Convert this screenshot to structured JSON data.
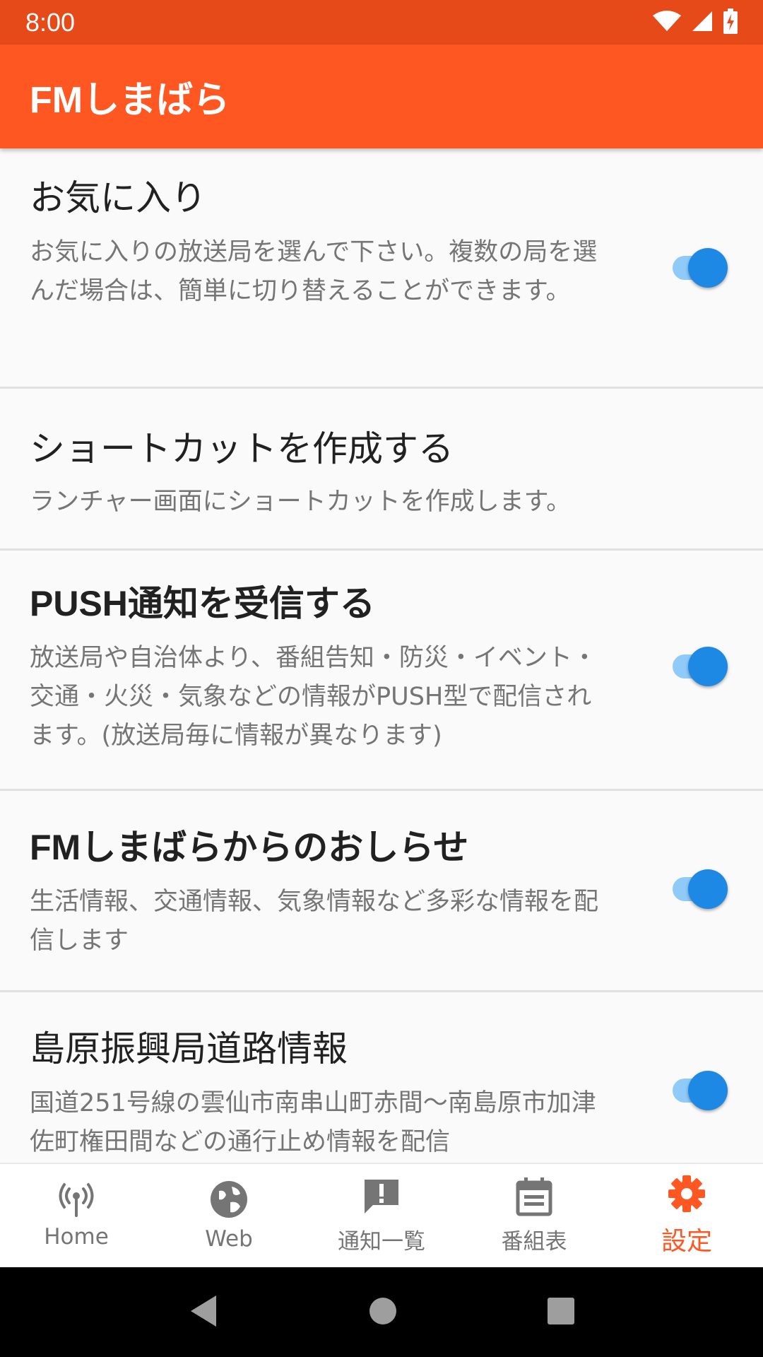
{
  "status_bar": {
    "time": "8:00",
    "icons": [
      "wifi-icon",
      "cell-signal-icon",
      "battery-charging-icon"
    ]
  },
  "app_bar": {
    "title": "FMしまばら"
  },
  "preferences": [
    {
      "title": "お気に入り",
      "summary": "お気に入りの放送局を選んで下さい。複数の局を選んだ場合は、簡単に切り替えることができます。",
      "switch_on": true
    },
    {
      "title": "ショートカットを作成する",
      "summary": "ランチャー画面にショートカットを作成します。"
    },
    {
      "title": "PUSH通知を受信する",
      "summary": "放送局や自治体より、番組告知・防災・イベント・交通・火災・気象などの情報がPUSH型で配信されます。(放送局毎に情報が異なります)",
      "switch_on": true
    },
    {
      "title": "FMしまばらからのおしらせ",
      "summary": "生活情報、交通情報、気象情報など多彩な情報を配信します",
      "switch_on": true
    },
    {
      "title": "島原振興局道路情報",
      "summary": "国道251号線の雲仙市南串山町赤間〜南島原市加津佐町権田間などの通行止め情報を配信",
      "switch_on": true
    }
  ],
  "bottom_nav": [
    {
      "label": "Home",
      "icon": "radio-tower-icon"
    },
    {
      "label": "Web",
      "icon": "globe-icon"
    },
    {
      "label": "通知一覧",
      "icon": "notification-alert-icon"
    },
    {
      "label": "番組表",
      "icon": "calendar-icon"
    },
    {
      "label": "設定",
      "icon": "gear-icon",
      "active": true
    }
  ],
  "colors": {
    "status_bar": "#e64a19",
    "app_bar": "#ff5722",
    "switch_thumb": "#1e88e5",
    "switch_track": "#90caf9",
    "nav_active": "#ff5722",
    "nav_inactive": "#757575"
  }
}
